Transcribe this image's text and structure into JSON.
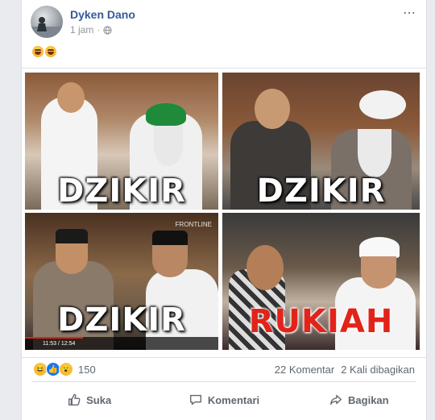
{
  "post": {
    "author": "Dyken Dano",
    "time": "1 jam",
    "separator": "·",
    "more_icon": "⋯",
    "message_emojis": [
      "face-with-tears-of-joy",
      "face-with-tears-of-joy"
    ]
  },
  "image": {
    "captions": [
      "DZIKIR",
      "DZIKIR",
      "DZIKIR",
      "RUKIAH"
    ],
    "watermark": "FRONTLINE",
    "video_time": "11:53 / 12:54"
  },
  "stats": {
    "reaction_icons": [
      "haha-icon",
      "like-icon",
      "wow-icon"
    ],
    "reaction_count": "150",
    "comments": "22 Komentar",
    "shares": "2 Kali dibagikan"
  },
  "actions": {
    "like": "Suka",
    "comment": "Komentari",
    "share": "Bagikan"
  },
  "colors": {
    "author_link": "#365899",
    "rukiah_caption": "#e2231a",
    "like_blue": "#1877f2"
  }
}
